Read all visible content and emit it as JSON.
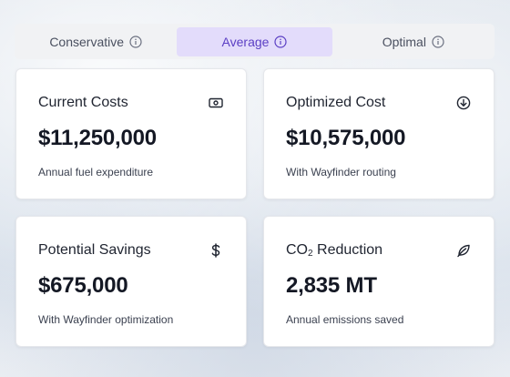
{
  "tabs": [
    {
      "label": "Conservative",
      "active": false
    },
    {
      "label": "Average",
      "active": true
    },
    {
      "label": "Optimal",
      "active": false
    }
  ],
  "cards": [
    {
      "title": "Current Costs",
      "value": "$11,250,000",
      "subtitle": "Annual fuel expenditure",
      "icon": "cash-icon"
    },
    {
      "title": "Optimized Cost",
      "value": "$10,575,000",
      "subtitle": "With Wayfinder routing",
      "icon": "arrow-down-circle-icon"
    },
    {
      "title": "Potential Savings",
      "value": "$675,000",
      "subtitle": "With Wayfinder optimization",
      "icon": "dollar-icon"
    },
    {
      "title_prefix": "CO",
      "title_subscript": "2",
      "title_suffix": " Reduction",
      "value": "2,835 MT",
      "subtitle": "Annual emissions saved",
      "icon": "leaf-icon"
    }
  ],
  "colors": {
    "accent": "#5b3fc4",
    "active_tab_bg": "#e3dcfb",
    "tab_bar_bg": "#f1f2f4",
    "text_primary": "#141824"
  }
}
